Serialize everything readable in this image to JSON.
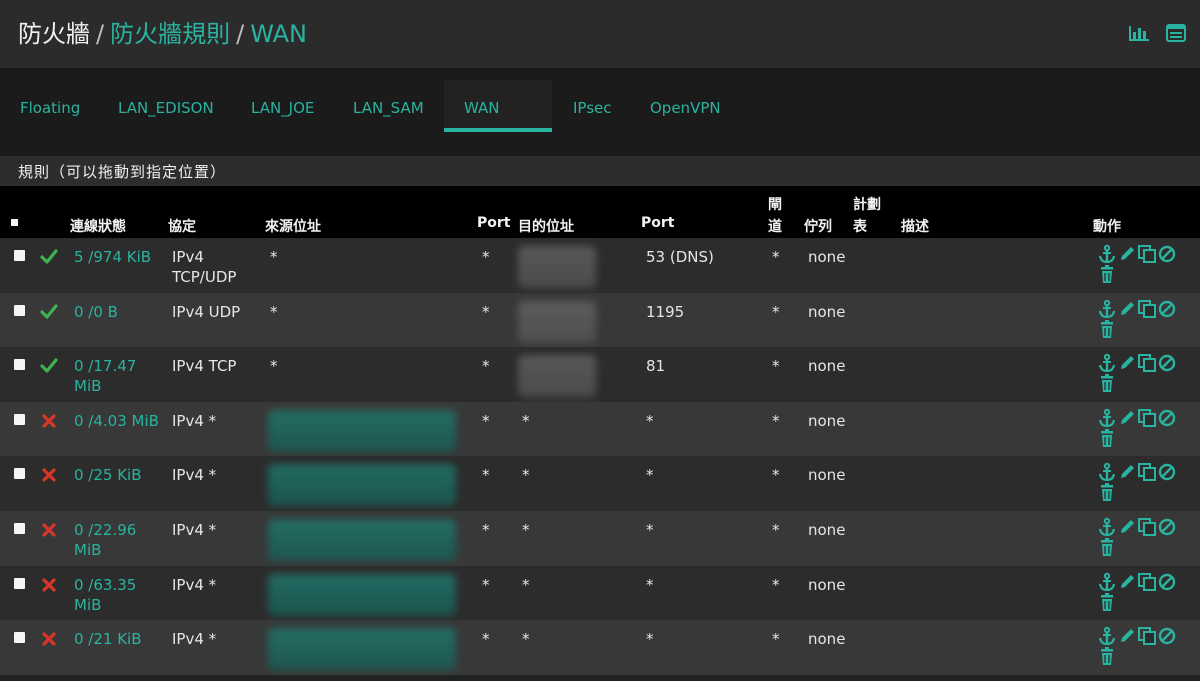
{
  "header": {
    "breadcrumb_root": "防火牆",
    "separator": "/",
    "breadcrumb_rules": "防火牆規則",
    "breadcrumb_current": "WAN",
    "icons": [
      "chart-icon",
      "table-icon"
    ]
  },
  "tabs": [
    {
      "label": "Floating",
      "active": false
    },
    {
      "label": "LAN_EDISON",
      "active": false
    },
    {
      "label": "LAN_JOE",
      "active": false
    },
    {
      "label": "LAN_SAM",
      "active": false
    },
    {
      "label": "WAN",
      "active": true
    },
    {
      "label": "IPsec",
      "active": false
    },
    {
      "label": "OpenVPN",
      "active": false
    }
  ],
  "panel": {
    "title": "規則（可以拖動到指定位置）"
  },
  "table": {
    "columns": {
      "states": "連線狀態",
      "protocol": "協定",
      "source": "來源位址",
      "source_port": "Port",
      "destination": "目的位址",
      "dest_port": "Port",
      "gateway_1": "閘",
      "gateway_2": "道",
      "queue": "佇列",
      "schedule_1": "計劃",
      "schedule_2": "表",
      "description": "描述",
      "actions": "動作"
    },
    "rows": [
      {
        "enabled": true,
        "states": "5 /974 KiB",
        "protocol": "IPv4\nTCP/UDP",
        "source": "*",
        "source_port": "*",
        "destination_blurred": true,
        "dest_port": "53 (DNS)",
        "gateway": "*",
        "queue": "none",
        "schedule": "",
        "description": ""
      },
      {
        "enabled": true,
        "states": "0 /0 B",
        "protocol": "IPv4 UDP",
        "source": "*",
        "source_port": "*",
        "destination_blurred": true,
        "dest_port": "1195",
        "gateway": "*",
        "queue": "none",
        "schedule": "",
        "description": ""
      },
      {
        "enabled": true,
        "states": "0 /17.47\nMiB",
        "protocol": "IPv4 TCP",
        "source": "*",
        "source_port": "*",
        "destination_blurred": true,
        "dest_port": "81",
        "gateway": "*",
        "queue": "none",
        "schedule": "",
        "description": ""
      },
      {
        "enabled": false,
        "states": "0 /4.03 MiB",
        "protocol": "IPv4 *",
        "source_blurred": true,
        "source_port": "*",
        "destination": "*",
        "dest_port": "*",
        "gateway": "*",
        "queue": "none",
        "schedule": "",
        "description": ""
      },
      {
        "enabled": false,
        "states": "0 /25 KiB",
        "protocol": "IPv4 *",
        "source_blurred": true,
        "source_port": "*",
        "destination": "*",
        "dest_port": "*",
        "gateway": "*",
        "queue": "none",
        "schedule": "",
        "description": ""
      },
      {
        "enabled": false,
        "states": "0 /22.96\nMiB",
        "protocol": "IPv4 *",
        "source_blurred": true,
        "source_port": "*",
        "destination": "*",
        "dest_port": "*",
        "gateway": "*",
        "queue": "none",
        "schedule": "",
        "description": ""
      },
      {
        "enabled": false,
        "states": "0 /63.35\nMiB",
        "protocol": "IPv4 *",
        "source_blurred": true,
        "source_port": "*",
        "destination": "*",
        "dest_port": "*",
        "gateway": "*",
        "queue": "none",
        "schedule": "",
        "description": ""
      },
      {
        "enabled": false,
        "states": "0 /21 KiB",
        "protocol": "IPv4 *",
        "source_blurred": true,
        "source_port": "*",
        "destination": "*",
        "dest_port": "*",
        "gateway": "*",
        "queue": "none",
        "schedule": "",
        "description": ""
      }
    ],
    "action_icons": [
      "anchor-icon",
      "pencil-icon",
      "copy-icon",
      "disable-icon",
      "trash-icon"
    ]
  },
  "colors": {
    "accent": "#2ab3a0",
    "enabled_check": "#3fb34f",
    "disabled_x": "#d9362b",
    "row_odd": "#2c2c2c",
    "row_even": "#383838",
    "header_bg": "#000000"
  }
}
